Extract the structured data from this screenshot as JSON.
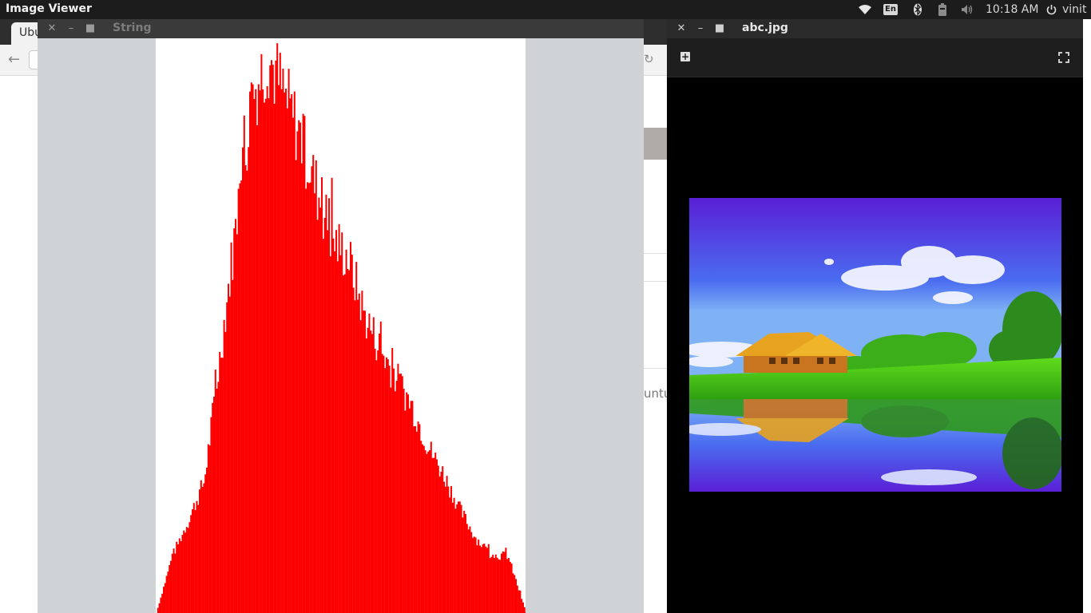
{
  "top_panel": {
    "app_title": "Image Viewer",
    "keyboard_layout": "En",
    "clock": "10:18 AM",
    "user": "vinit",
    "icons": [
      "wifi-icon",
      "bluetooth-icon",
      "battery-icon",
      "volume-icon",
      "power-icon"
    ]
  },
  "background_browser": {
    "tab_label": "Ubu",
    "partial_text": "untu"
  },
  "histogram_window": {
    "title": "String",
    "bar_color": "#ff0000",
    "background_color": "#ffffff"
  },
  "viewer_window": {
    "title": "abc.jpg",
    "toolbar": {
      "zoom_icon": "zoom-in-icon",
      "fullscreen_icon": "fullscreen-icon"
    }
  },
  "chart_data": {
    "type": "bar",
    "x": [
      0,
      20,
      40,
      60,
      80,
      100,
      120,
      140,
      160,
      180,
      200,
      220,
      240,
      260,
      280,
      300,
      320,
      340,
      360,
      380,
      400,
      420,
      440,
      463
    ],
    "values": [
      0.0,
      0.1,
      0.16,
      0.23,
      0.45,
      0.68,
      0.9,
      0.97,
      0.9,
      0.83,
      0.74,
      0.65,
      0.62,
      0.52,
      0.46,
      0.41,
      0.36,
      0.29,
      0.24,
      0.18,
      0.13,
      0.1,
      0.1,
      0.0
    ],
    "title": "",
    "xlabel": "",
    "ylabel": ""
  }
}
